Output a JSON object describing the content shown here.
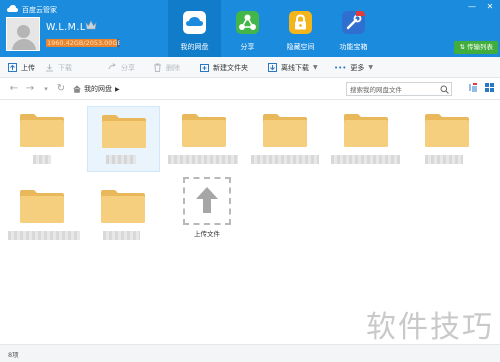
{
  "window": {
    "title": "百度云管家",
    "controls": [
      "minimize-icon",
      "close-icon"
    ]
  },
  "user": {
    "name": "W.L.M.L",
    "quota_text": "1960.42GB/2053.00GB",
    "quota_fraction": 0.955,
    "vip_icon": "crown-icon"
  },
  "nav": {
    "items": [
      {
        "label": "我的网盘",
        "icon": "cloud-drive-icon",
        "active": true
      },
      {
        "label": "分享",
        "icon": "share-icon"
      },
      {
        "label": "隐藏空间",
        "icon": "lock-icon"
      },
      {
        "label": "功能宝箱",
        "icon": "toolbox-icon"
      }
    ],
    "upload_list_label": "传输列表"
  },
  "toolbar": {
    "upload": "上传",
    "download": "下载",
    "share": "分享",
    "delete": "删除",
    "new_folder": "新建文件夹",
    "offline_download": "离线下载",
    "more": "更多"
  },
  "address": {
    "breadcrumb": "我的网盘",
    "search_placeholder": "搜索我的网盘文件"
  },
  "content": {
    "upload_label": "上传文件"
  },
  "status": {
    "count_text": "8项"
  },
  "watermark": "软件技巧",
  "colors": {
    "header_blue": "#1a8bdd",
    "folder_yellow": "#f5cf7d",
    "green": "#41ad3d",
    "quota_orange": "#e9852f"
  }
}
